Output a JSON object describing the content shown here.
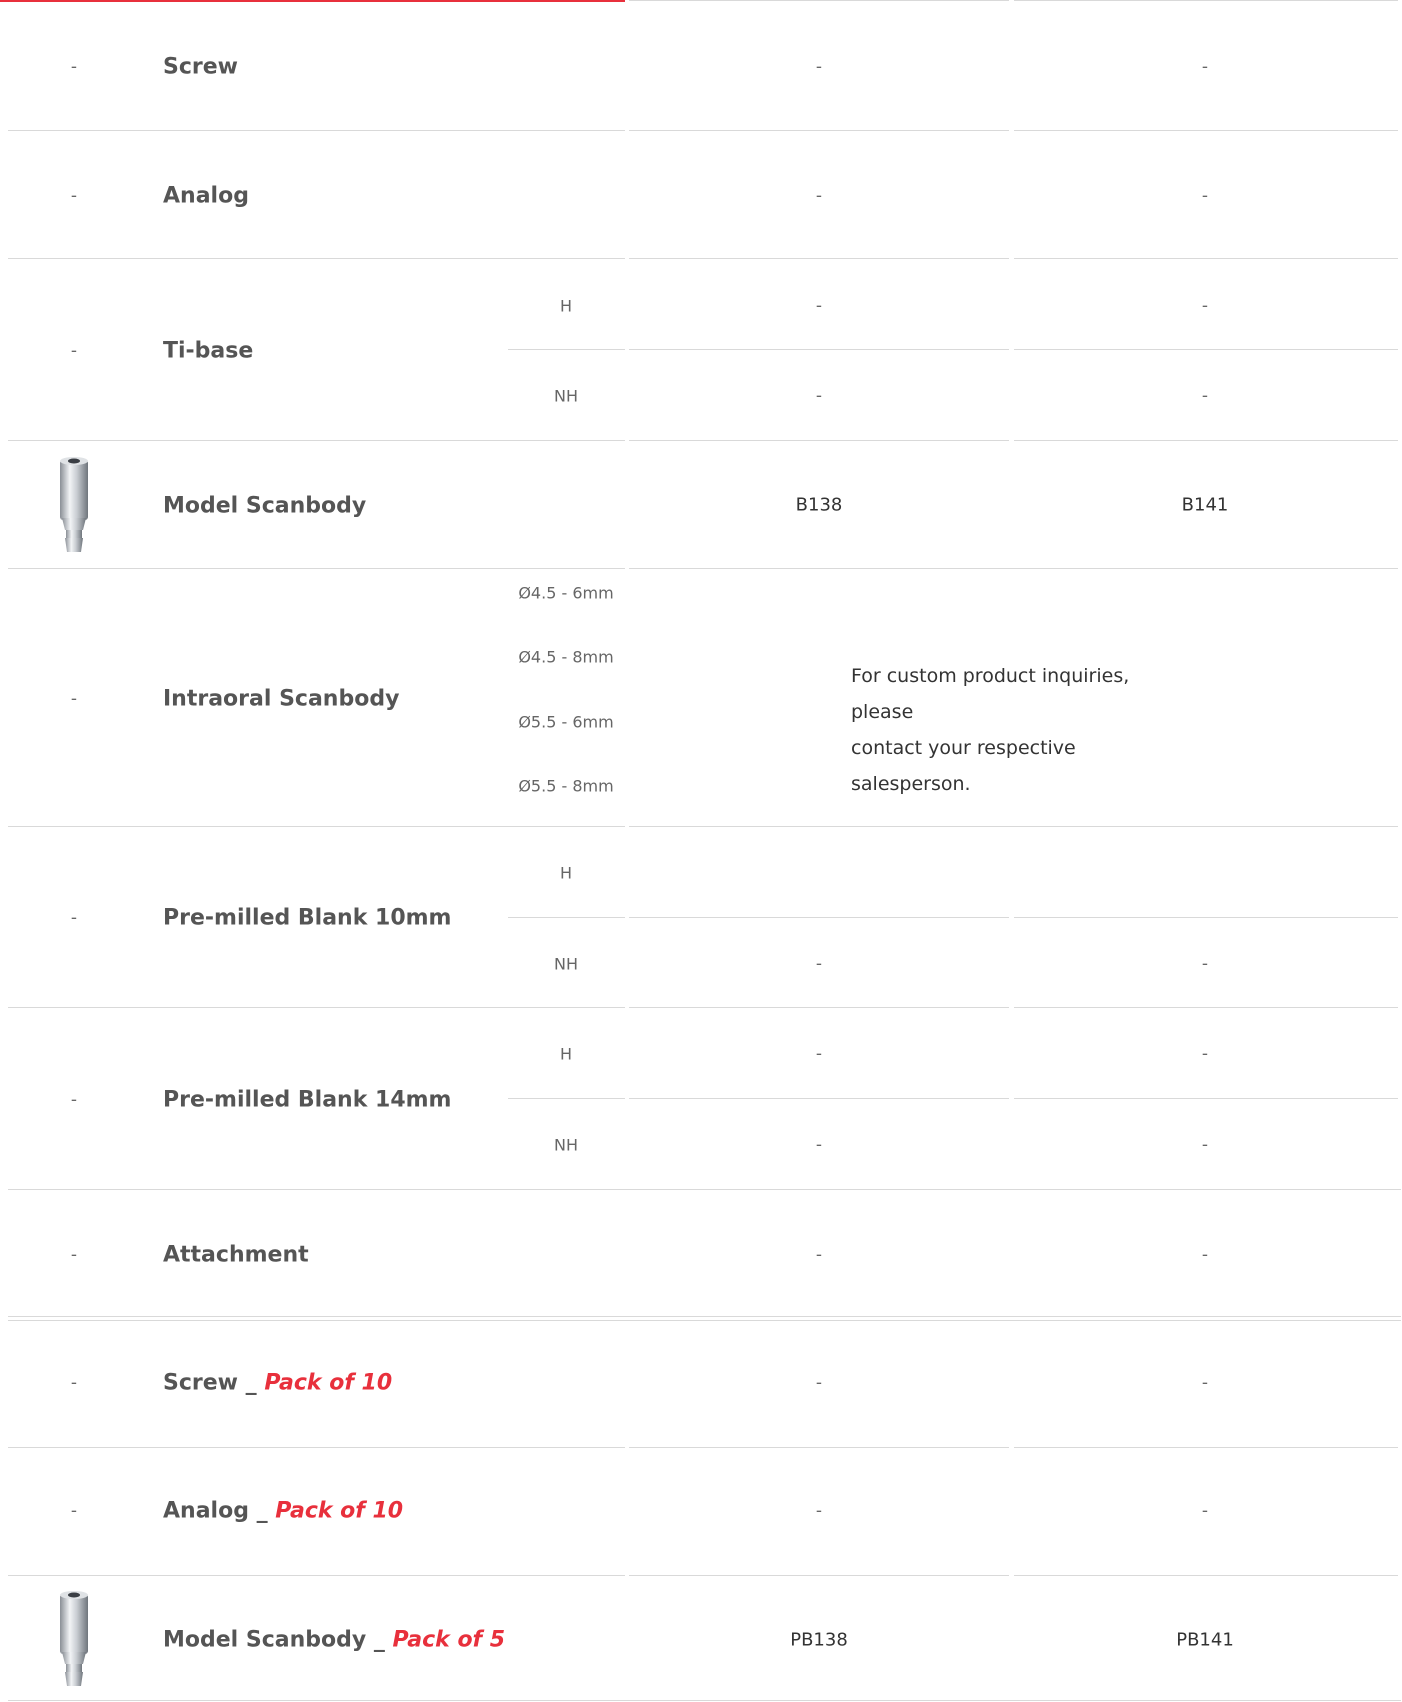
{
  "colors": {
    "accent": "#e8303c",
    "rule": "#d9d9d9",
    "label": "#555555"
  },
  "icons": {
    "product_image": "scanbody-implant-icon"
  },
  "rows": [
    {
      "thumb": "-",
      "name": "Screw",
      "col1": "-",
      "col2": "-"
    },
    {
      "thumb": "-",
      "name": "Analog",
      "col1": "-",
      "col2": "-"
    },
    {
      "thumb": "-",
      "name": "Ti-base",
      "subrows": [
        {
          "label": "H",
          "col1": "-",
          "col2": "-"
        },
        {
          "label": "NH",
          "col1": "-",
          "col2": "-"
        }
      ]
    },
    {
      "thumb": "image",
      "name": "Model Scanbody",
      "col1": "B138",
      "col2": "B141"
    },
    {
      "thumb": "-",
      "name": "Intraoral Scanbody",
      "sizes": [
        "Ø4.5 - 6mm",
        "Ø4.5 - 8mm",
        "Ø5.5 - 6mm",
        "Ø5.5 - 8mm"
      ],
      "note_line1": "For custom product inquiries, please",
      "note_line2": "contact your respective salesperson."
    },
    {
      "thumb": "-",
      "name": "Pre-milled Blank 10mm",
      "subrows": [
        {
          "label": "H",
          "col1": "",
          "col2": ""
        },
        {
          "label": "NH",
          "col1": "-",
          "col2": "-"
        }
      ]
    },
    {
      "thumb": "-",
      "name": "Pre-milled Blank 14mm",
      "subrows": [
        {
          "label": "H",
          "col1": "-",
          "col2": "-"
        },
        {
          "label": "NH",
          "col1": "-",
          "col2": "-"
        }
      ]
    },
    {
      "thumb": "-",
      "name": "Attachment",
      "col1": "-",
      "col2": "-"
    }
  ],
  "pack_rows": [
    {
      "thumb": "-",
      "name": "Screw _ ",
      "pack": "Pack of 10",
      "col1": "-",
      "col2": "-"
    },
    {
      "thumb": "-",
      "name": "Analog _ ",
      "pack": "Pack of 10",
      "col1": "-",
      "col2": "-"
    },
    {
      "thumb": "image",
      "name": "Model Scanbody _ ",
      "pack": "Pack of 5",
      "col1": "PB138",
      "col2": "PB141"
    }
  ]
}
